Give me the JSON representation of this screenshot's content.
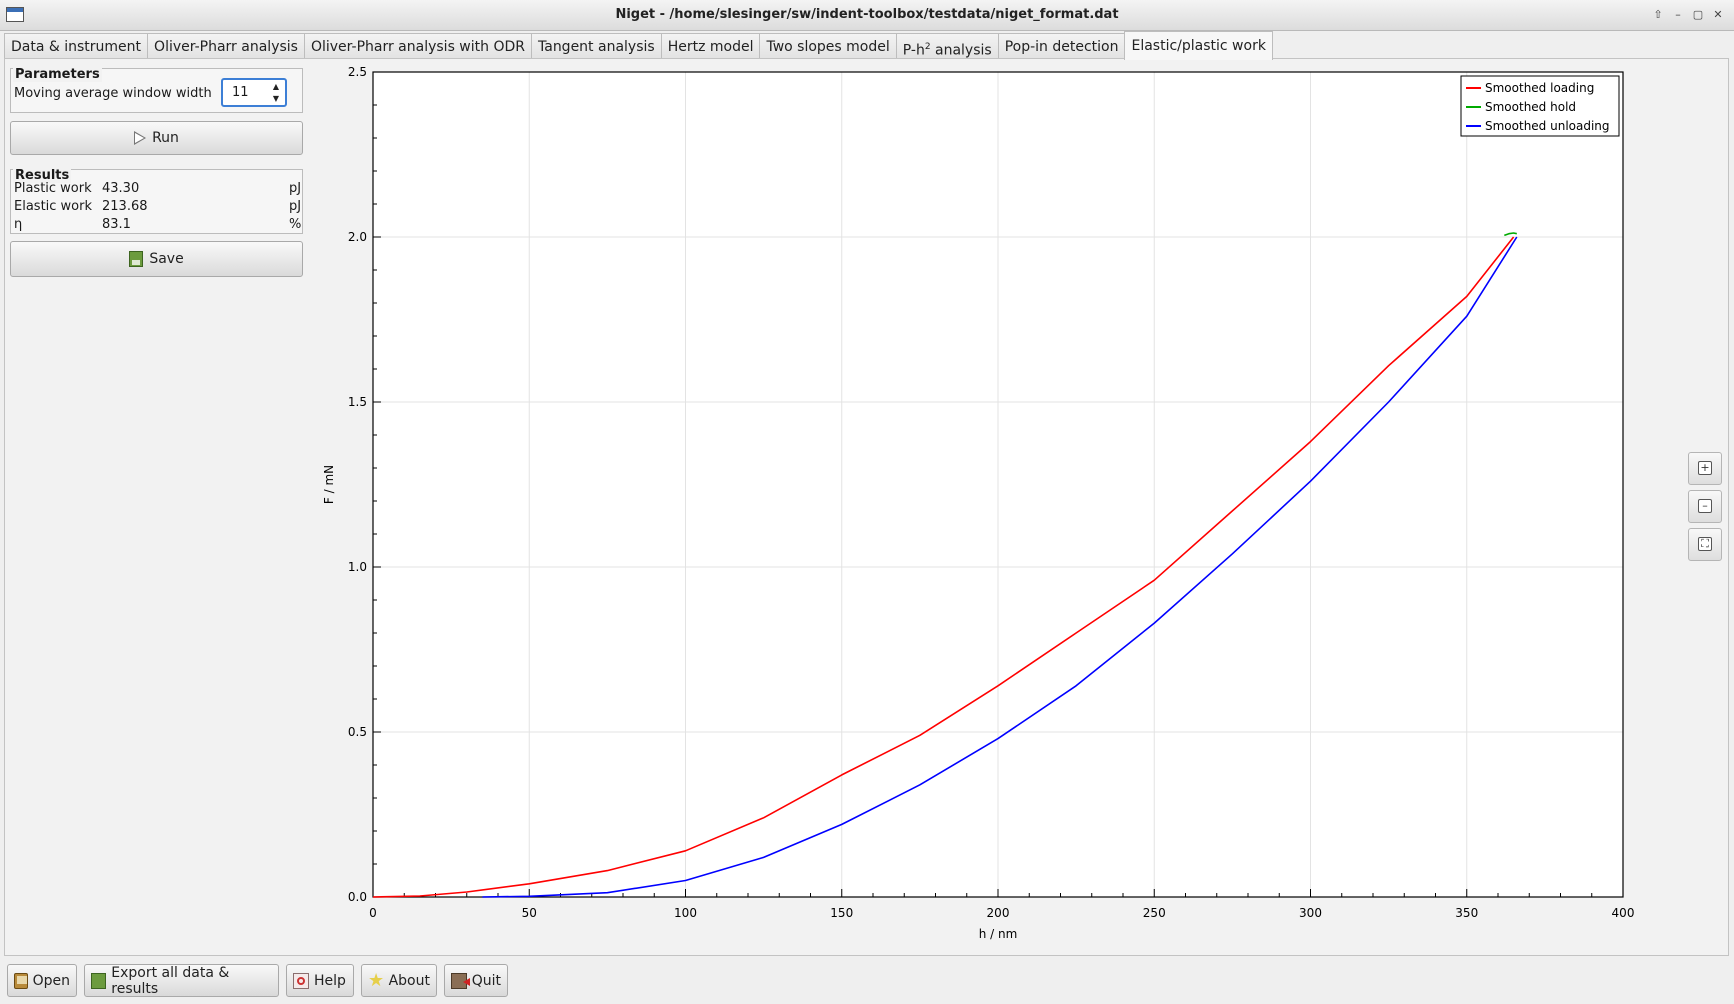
{
  "window": {
    "title": "Niget - /home/slesinger/sw/indent-toolbox/testdata/niget_format.dat",
    "controls": [
      "⇧",
      "–",
      "▢",
      "✕"
    ]
  },
  "tabs": [
    {
      "label": "Data & instrument"
    },
    {
      "label": "Oliver-Pharr analysis"
    },
    {
      "label": "Oliver-Pharr analysis with ODR"
    },
    {
      "label": "Tangent analysis"
    },
    {
      "label": "Hertz model"
    },
    {
      "label": "Two slopes model"
    },
    {
      "label_main": "P-h",
      "label_sup": "2",
      "label_rest": " analysis"
    },
    {
      "label": "Pop-in detection"
    },
    {
      "label": "Elastic/plastic work",
      "active": true
    }
  ],
  "parameters": {
    "title": "Parameters",
    "window_label": "Moving average window width",
    "window_value": "11"
  },
  "run_button": {
    "label": "Run"
  },
  "results": {
    "title": "Results",
    "rows": [
      {
        "label": "Plastic work",
        "value": "43.30",
        "unit": "pJ"
      },
      {
        "label": "Elastic work",
        "value": "213.68",
        "unit": "pJ"
      },
      {
        "label": "η",
        "value": "83.1",
        "unit": "%"
      }
    ]
  },
  "save_button": {
    "label": "Save"
  },
  "bottom_toolbar": {
    "open": "Open",
    "export": "Export all data & results",
    "help": "Help",
    "about": "About",
    "quit": "Quit"
  },
  "chart_data": {
    "type": "line",
    "xlabel": "h / nm",
    "ylabel": "F / mN",
    "xlim": [
      0,
      400
    ],
    "ylim": [
      0,
      2.5
    ],
    "xticks": [
      0,
      50,
      100,
      150,
      200,
      250,
      300,
      350,
      400
    ],
    "yticks": [
      "0.0",
      "0.5",
      "1.0",
      "1.5",
      "2.0",
      "2.5"
    ],
    "grid": true,
    "legend_position": "top-right",
    "series": [
      {
        "name": "Smoothed loading",
        "color": "#ff0000",
        "x": [
          0,
          15,
          30,
          50,
          75,
          100,
          125,
          150,
          175,
          200,
          225,
          250,
          275,
          300,
          325,
          350,
          365
        ],
        "y": [
          0.0,
          0.003,
          0.015,
          0.04,
          0.08,
          0.14,
          0.24,
          0.37,
          0.49,
          0.64,
          0.8,
          0.96,
          1.17,
          1.38,
          1.61,
          1.82,
          2.0
        ]
      },
      {
        "name": "Smoothed hold",
        "color": "#00aa00",
        "x": [
          362,
          363.5,
          365,
          366
        ],
        "y": [
          2.005,
          2.01,
          2.012,
          2.01
        ]
      },
      {
        "name": "Smoothed unloading",
        "color": "#0000ff",
        "x": [
          35,
          50,
          75,
          100,
          125,
          150,
          175,
          200,
          225,
          250,
          275,
          300,
          325,
          350,
          366
        ],
        "y": [
          0.0,
          0.002,
          0.013,
          0.05,
          0.12,
          0.22,
          0.34,
          0.48,
          0.64,
          0.83,
          1.04,
          1.26,
          1.5,
          1.76,
          2.0
        ]
      }
    ]
  }
}
